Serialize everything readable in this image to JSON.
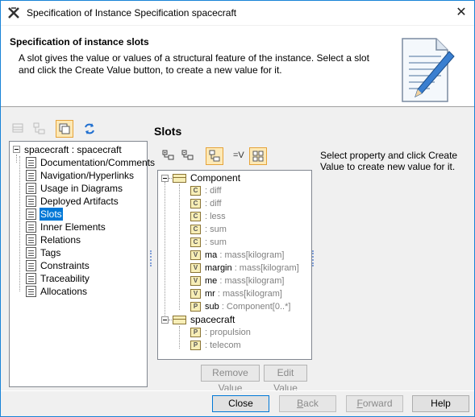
{
  "window": {
    "title": "Specification of Instance Specification spacecraft",
    "close_glyph": "✕"
  },
  "header": {
    "title": "Specification of instance slots",
    "description": "A slot gives the value or values of a structural feature of the instance. Select a slot and click the Create Value button, to create a new value for it.",
    "icon": "document-edit-icon"
  },
  "left_tree": {
    "root": "spacecraft : spacecraft",
    "items": [
      {
        "label": "Documentation/Comments"
      },
      {
        "label": "Navigation/Hyperlinks"
      },
      {
        "label": "Usage in Diagrams"
      },
      {
        "label": "Deployed Artifacts"
      },
      {
        "label": "Slots",
        "selected": true
      },
      {
        "label": "Inner Elements"
      },
      {
        "label": "Relations"
      },
      {
        "label": "Tags"
      },
      {
        "label": "Constraints"
      },
      {
        "label": "Traceability"
      },
      {
        "label": "Allocations"
      }
    ]
  },
  "slots": {
    "title": "Slots",
    "toolbar_text": "=V",
    "groups": [
      {
        "name": "Component",
        "slots": [
          {
            "badge": "C",
            "name": "",
            "type": ": diff"
          },
          {
            "badge": "C",
            "name": "",
            "type": ": diff"
          },
          {
            "badge": "C",
            "name": "",
            "type": ": less"
          },
          {
            "badge": "C",
            "name": "",
            "type": ": sum"
          },
          {
            "badge": "C",
            "name": "",
            "type": ": sum"
          },
          {
            "badge": "V",
            "name": "ma",
            "type": ": mass[kilogram]"
          },
          {
            "badge": "V",
            "name": "margin",
            "type": ": mass[kilogram]"
          },
          {
            "badge": "V",
            "name": "me",
            "type": ": mass[kilogram]"
          },
          {
            "badge": "V",
            "name": "mr",
            "type": ": mass[kilogram]"
          },
          {
            "badge": "P",
            "name": "sub",
            "type": ": Component[0..*]"
          }
        ]
      },
      {
        "name": "spacecraft",
        "slots": [
          {
            "badge": "P",
            "name": "",
            "type": ": propulsion"
          },
          {
            "badge": "P",
            "name": "",
            "type": ": telecom"
          }
        ]
      }
    ],
    "info": "Select property and click Create Value to create new value for it.",
    "remove_value": "Remove Value",
    "edit_value": "Edit Value"
  },
  "buttons": {
    "close": "Close",
    "back_pre": "",
    "back_u": "B",
    "back_post": "ack",
    "forward_pre": "",
    "forward_u": "F",
    "forward_post": "orward",
    "help": "Help"
  }
}
